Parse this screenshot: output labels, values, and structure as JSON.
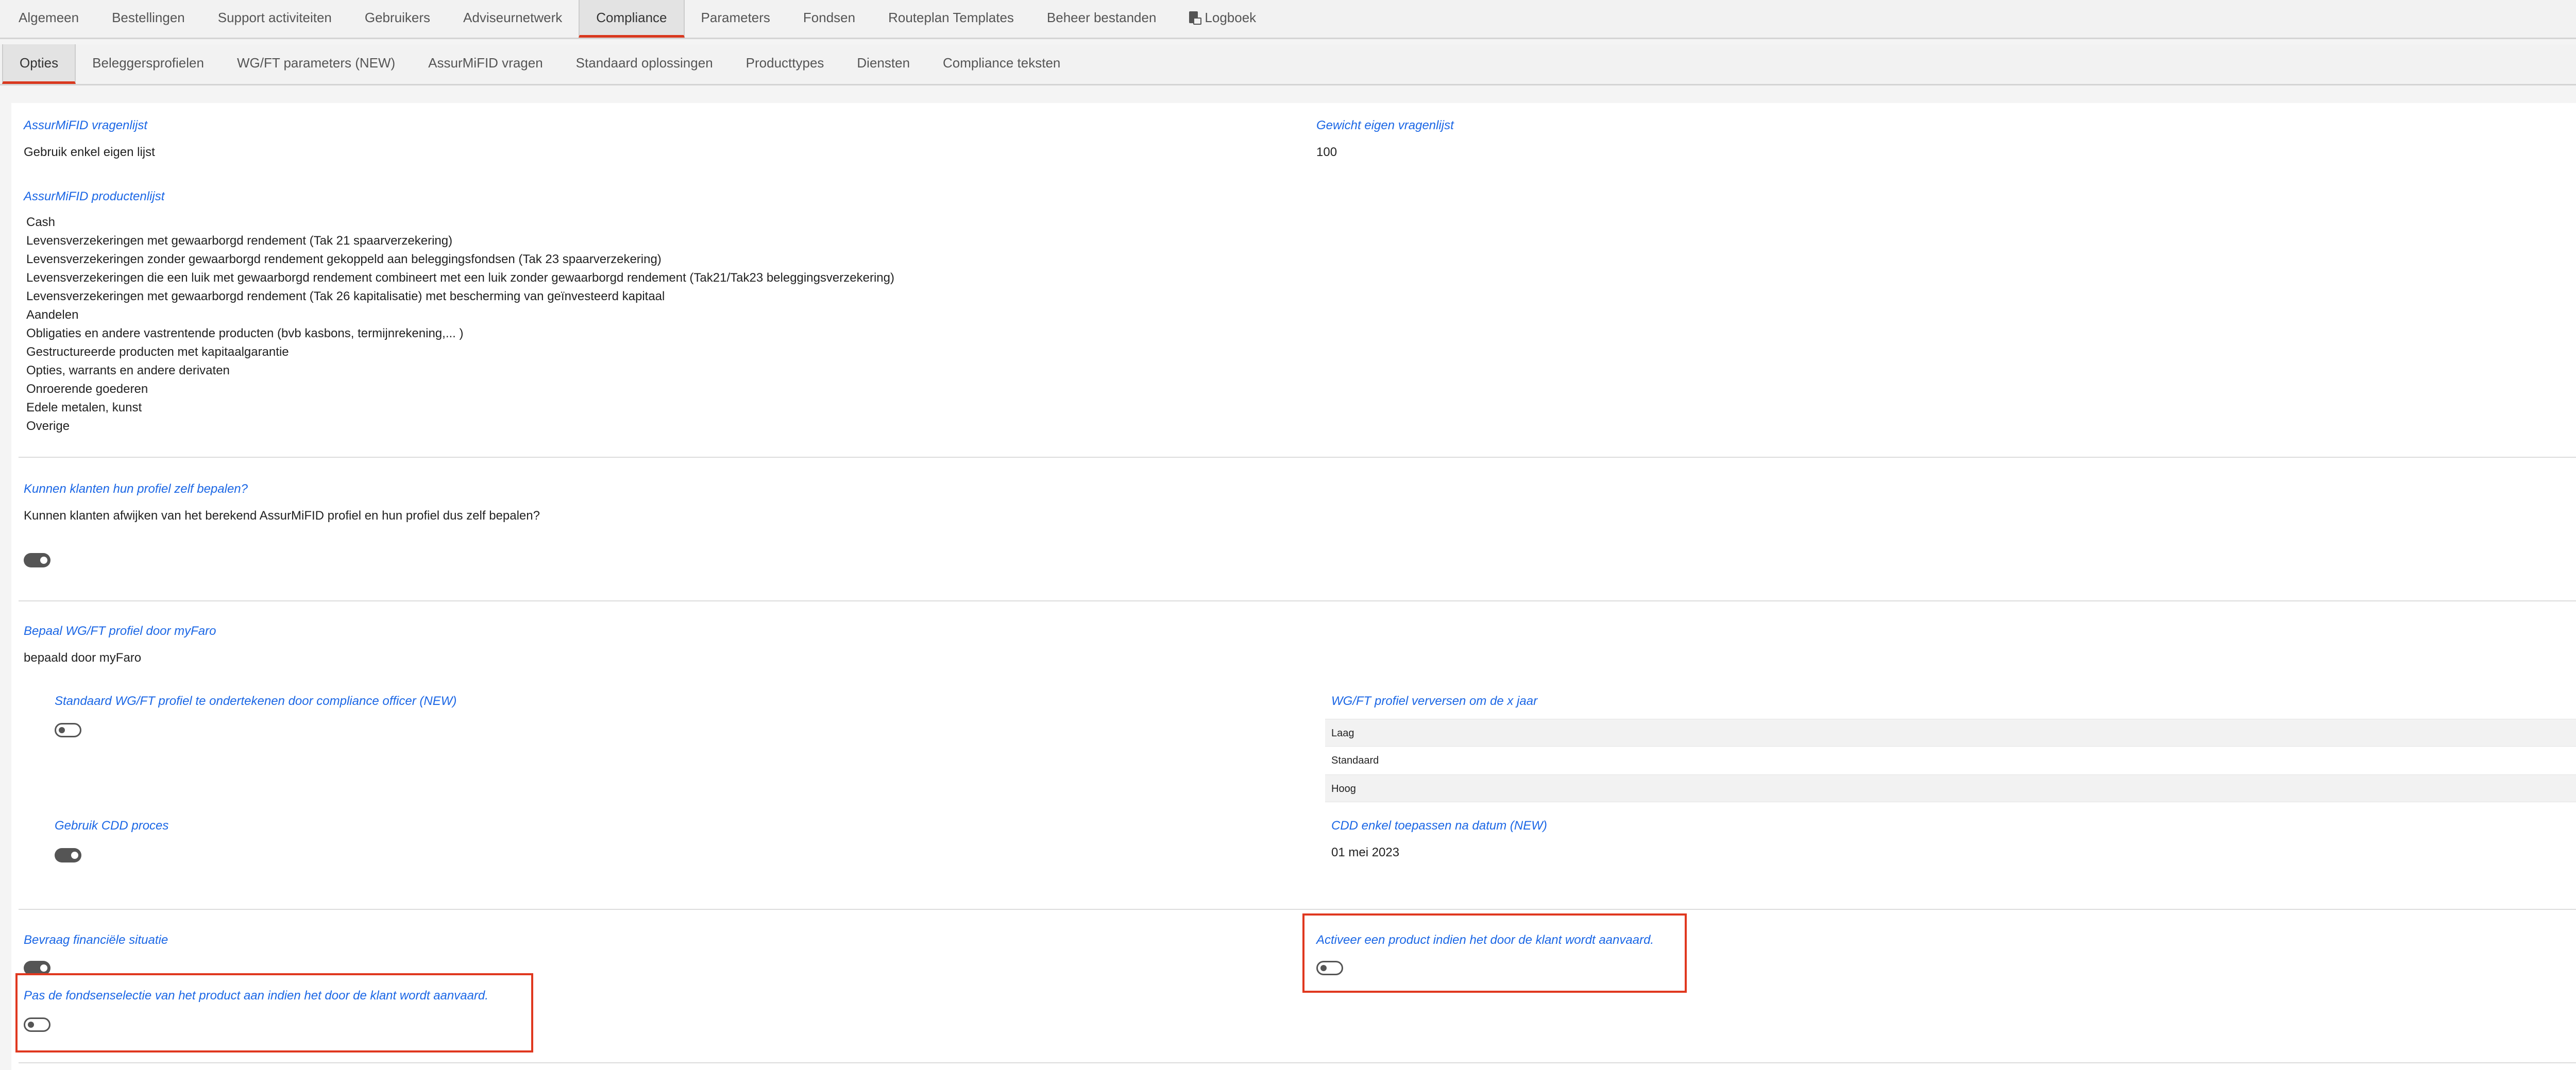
{
  "main_tabs": [
    {
      "label": "Algemeen"
    },
    {
      "label": "Bestellingen"
    },
    {
      "label": "Support activiteiten"
    },
    {
      "label": "Gebruikers"
    },
    {
      "label": "Adviseurnetwerk"
    },
    {
      "label": "Compliance"
    },
    {
      "label": "Parameters"
    },
    {
      "label": "Fondsen"
    },
    {
      "label": "Routeplan Templates"
    },
    {
      "label": "Beheer bestanden"
    },
    {
      "label": "Logboek"
    }
  ],
  "main_active": "Compliance",
  "sub_tabs": [
    {
      "label": "Opties"
    },
    {
      "label": "Beleggersprofielen"
    },
    {
      "label": "WG/FT parameters (NEW)"
    },
    {
      "label": "AssurMiFID vragen"
    },
    {
      "label": "Standaard oplossingen"
    },
    {
      "label": "Producttypes"
    },
    {
      "label": "Diensten"
    },
    {
      "label": "Compliance teksten"
    }
  ],
  "sub_active": "Opties",
  "sections": {
    "vragenlijst": {
      "label": "AssurMiFID vragenlijst",
      "value": "Gebruik enkel eigen lijst"
    },
    "gewicht": {
      "label": "Gewicht eigen vragenlijst",
      "value": "100"
    },
    "productenlijst": {
      "label": "AssurMiFID productenlijst",
      "items": [
        "Cash",
        "Levensverzekeringen met gewaarborgd rendement (Tak 21 spaarverzekering)",
        "Levensverzekeringen zonder gewaarborgd rendement gekoppeld aan beleggingsfondsen (Tak 23 spaarverzekering)",
        "Levensverzekeringen die een luik met gewaarborgd rendement combineert met een luik zonder gewaarborgd rendement (Tak21/Tak23 beleggingsverzekering)",
        "Levensverzekeringen met gewaarborgd rendement (Tak 26 kapitalisatie) met bescherming van geïnvesteerd kapitaal",
        "Aandelen",
        "Obligaties en andere vastrentende producten (bvb kasbons, termijnrekening,... )",
        "Gestructureerde producten met kapitaalgarantie",
        "Opties, warrants en andere derivaten",
        "Onroerende goederen",
        "Edele metalen, kunst",
        "Overige"
      ]
    },
    "profiel_zelf": {
      "label": "Kunnen klanten hun profiel zelf bepalen?",
      "text": "Kunnen klanten afwijken van het berekend AssurMiFID profiel en hun profiel dus zelf bepalen?",
      "enabled": true
    },
    "wgft": {
      "label": "Bepaal WG/FT profiel door myFaro",
      "value": "bepaald door myFaro"
    },
    "standaard_wgft": {
      "label": "Standaard WG/FT profiel te ondertekenen door compliance officer (NEW)",
      "enabled": false
    },
    "verversen": {
      "label": "WG/FT profiel verversen om de x jaar",
      "options": [
        "Laag",
        "Standaard",
        "Hoog"
      ]
    },
    "cdd": {
      "label": "Gebruik CDD proces",
      "enabled": true
    },
    "cdd_datum": {
      "label": "CDD enkel toepassen na datum (NEW)",
      "value": "01 mei 2023"
    },
    "financiele": {
      "label": "Bevraag financiële situatie",
      "enabled": true
    },
    "activeer": {
      "label": "Activeer een product indien het door de klant wordt aanvaard.",
      "enabled": false
    },
    "fondsenselectie": {
      "label": "Pas de fondsenselectie van het product aan indien het door de klant wordt aanvaard.",
      "enabled": false
    }
  },
  "colors": {
    "accent": "#d9381e",
    "label": "#1a66e5",
    "highlight": "#e0381f"
  }
}
